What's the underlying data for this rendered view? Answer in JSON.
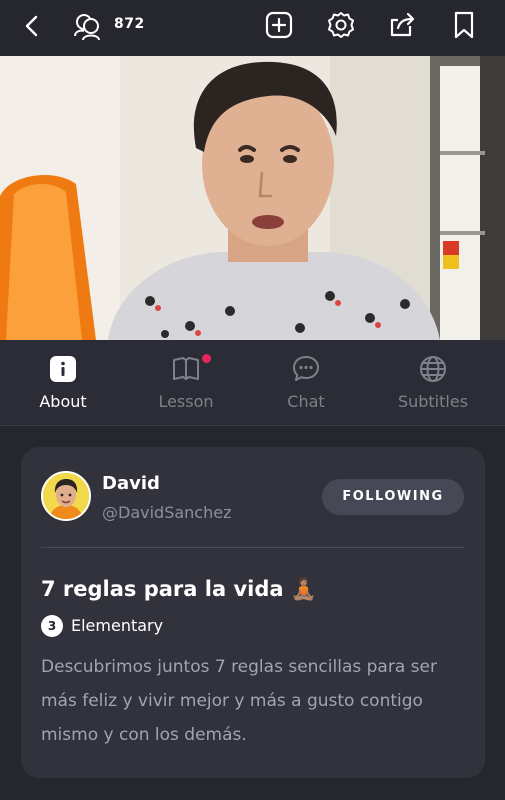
{
  "header": {
    "viewer_count": "872",
    "icons": [
      "back-chevron-icon",
      "viewers-icon",
      "add-icon",
      "settings-icon",
      "share-icon",
      "bookmark-icon"
    ]
  },
  "video": {
    "icon": "video-frame"
  },
  "tabs": [
    {
      "label": "About",
      "icon": "info-icon",
      "active": true
    },
    {
      "label": "Lesson",
      "icon": "book-icon",
      "active": false,
      "notification_dot": true
    },
    {
      "label": "Chat",
      "icon": "chat-bubble-icon",
      "active": false
    },
    {
      "label": "Subtitles",
      "icon": "globe-icon",
      "active": false
    }
  ],
  "card": {
    "name": "David",
    "handle": "@DavidSanchez",
    "follow_label": "FOLLOWING",
    "lesson_title": "7 reglas para la vida 🧘🏽",
    "level_number": "3",
    "level_label": "Elementary",
    "description": "Descubrimos juntos 7 reglas sencillas para ser más feliz y vivir mejor y más a gusto contigo mismo y con los demás."
  },
  "colors": {
    "background": "#25262e",
    "card": "#31323c",
    "notification": "#e8245c",
    "muted_text": "#a3a4ae"
  }
}
